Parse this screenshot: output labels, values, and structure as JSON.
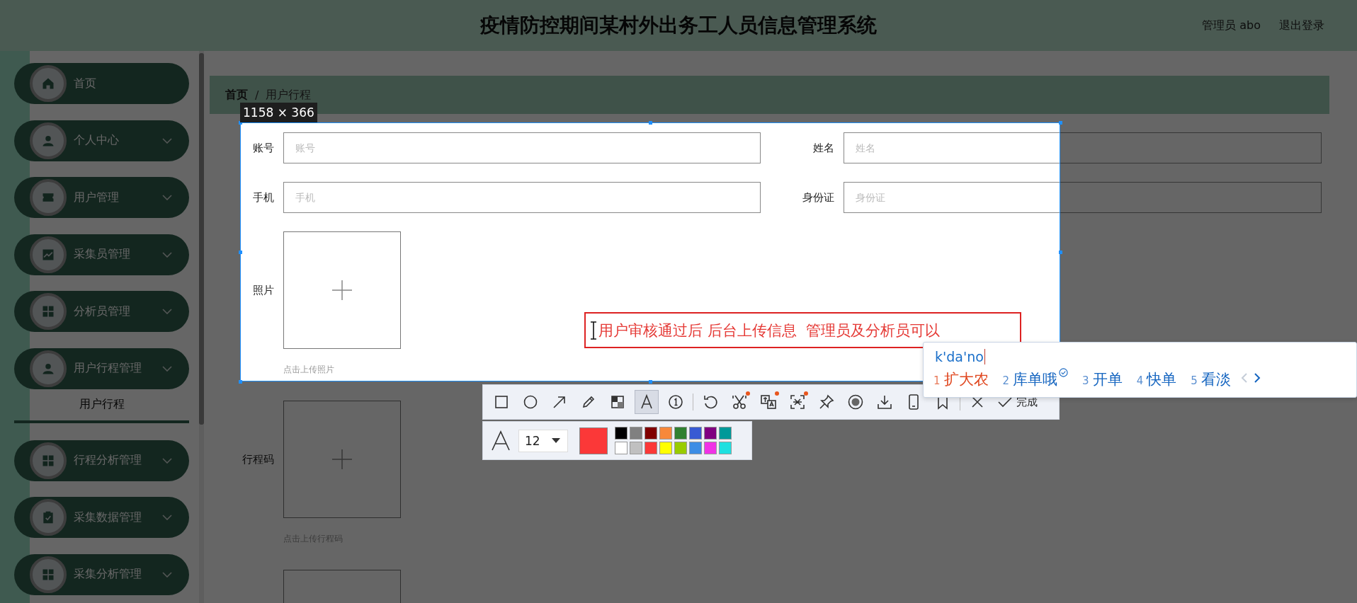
{
  "header": {
    "title": "疫情防控期间某村外出务工人员信息管理系统",
    "user": "管理员 abo",
    "logout": "退出登录"
  },
  "sidebar": {
    "items": [
      {
        "label": "首页",
        "kind": "home",
        "expandable": false
      },
      {
        "label": "个人中心",
        "kind": "person",
        "expandable": true
      },
      {
        "label": "用户管理",
        "kind": "ticket",
        "expandable": true
      },
      {
        "label": "采集员管理",
        "kind": "chart",
        "expandable": true
      },
      {
        "label": "分析员管理",
        "kind": "grid",
        "expandable": true
      },
      {
        "label": "用户行程管理",
        "kind": "person",
        "expandable": true,
        "children": [
          {
            "label": "用户行程",
            "selected": true
          }
        ]
      },
      {
        "label": "行程分析管理",
        "kind": "grid",
        "expandable": true
      },
      {
        "label": "采集数据管理",
        "kind": "clipboard",
        "expandable": true
      },
      {
        "label": "采集分析管理",
        "kind": "grid",
        "expandable": true
      }
    ]
  },
  "breadcrumb": {
    "items": [
      "首页",
      "用户行程"
    ],
    "separator": "/"
  },
  "form": {
    "fields": [
      {
        "label": "账号",
        "placeholder": "账号"
      },
      {
        "label": "姓名",
        "placeholder": "姓名"
      },
      {
        "label": "手机",
        "placeholder": "手机"
      },
      {
        "label": "身份证",
        "placeholder": "身份证"
      }
    ],
    "uploads": [
      {
        "kind": "image_upload",
        "label": "照片",
        "hint": "点击上传照片"
      },
      {
        "kind": "image_upload",
        "label": "行程码",
        "hint": "点击上传行程码"
      },
      {
        "kind": "image_upload"
      }
    ]
  },
  "screenshot_tool": {
    "size": "1158 × 366",
    "annotation": "用户审核通过后 后台上传信息  管理员及分析员可以",
    "tool_groups": [
      [
        {
          "kind": "rectangle",
          "selected": false,
          "badge": false
        },
        {
          "kind": "ellipse",
          "selected": false,
          "badge": false
        },
        {
          "kind": "arrow",
          "selected": false,
          "badge": false
        },
        {
          "kind": "pencil",
          "selected": false,
          "badge": false
        },
        {
          "kind": "mosaic",
          "selected": false,
          "badge": false
        },
        {
          "kind": "text",
          "selected": true,
          "badge": false
        },
        {
          "kind": "number",
          "selected": false,
          "badge": false
        }
      ],
      [
        {
          "kind": "undo",
          "selected": false,
          "badge": false
        },
        {
          "kind": "scissors",
          "selected": false,
          "badge": true
        },
        {
          "kind": "translate",
          "selected": false,
          "badge": true
        },
        {
          "kind": "ocr",
          "selected": false,
          "badge": true
        },
        {
          "kind": "pin",
          "selected": false,
          "badge": false
        },
        {
          "kind": "record",
          "selected": false,
          "badge": false
        },
        {
          "kind": "download",
          "selected": false,
          "badge": false
        },
        {
          "kind": "phone",
          "selected": false,
          "badge": false
        },
        {
          "kind": "bookmark",
          "selected": false,
          "badge": false
        }
      ],
      [
        {
          "kind": "close",
          "selected": false,
          "badge": false
        }
      ]
    ],
    "done": "完成",
    "text_style": {
      "font_size": "12",
      "current": {
        "color": "#fb3838"
      },
      "palette": [
        {
          "color": "#000000"
        },
        {
          "color": "#808080"
        },
        {
          "color": "#800000"
        },
        {
          "color": "#f7883a"
        },
        {
          "color": "#308030"
        },
        {
          "color": "#385ad3"
        },
        {
          "color": "#800080"
        },
        {
          "color": "#009999"
        },
        {
          "color": "#ffffff"
        },
        {
          "color": "#c0c0c0"
        },
        {
          "color": "#fb3838"
        },
        {
          "color": "#ffff00"
        },
        {
          "color": "#99cc00"
        },
        {
          "color": "#3d8de5"
        },
        {
          "color": "#f032e6"
        },
        {
          "color": "#1ee0e0"
        }
      ]
    }
  },
  "input_method": {
    "composition": "k'da'no",
    "candidates": [
      {
        "index": "1",
        "text": "扩大农",
        "selected": true,
        "verified": false
      },
      {
        "index": "2",
        "text": "库单哦",
        "selected": false,
        "verified": true
      },
      {
        "index": "3",
        "text": "开单",
        "selected": false,
        "verified": false
      },
      {
        "index": "4",
        "text": "快单",
        "selected": false,
        "verified": false
      },
      {
        "index": "5",
        "text": "看淡",
        "selected": false,
        "verified": false
      }
    ],
    "prev_disabled": true,
    "next_disabled": false
  }
}
